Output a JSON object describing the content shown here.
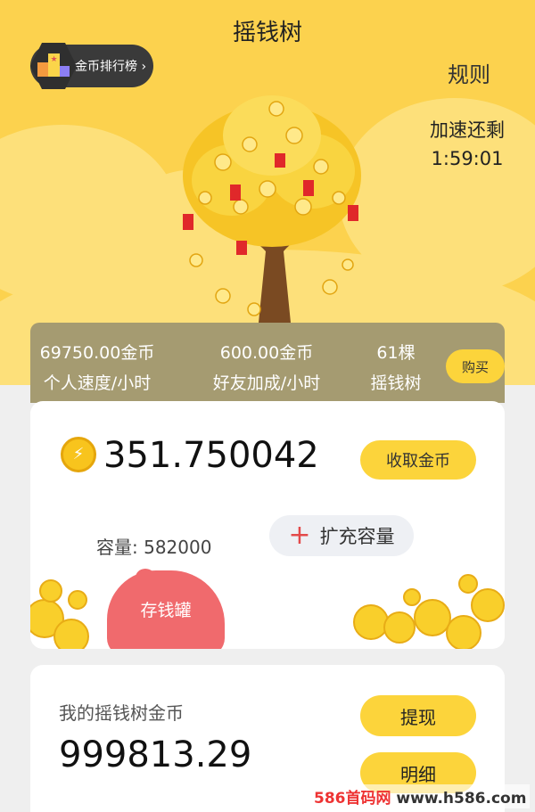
{
  "header": {
    "title": "摇钱树",
    "rank_label": "金币排行榜 ›",
    "rules_label": "规则"
  },
  "speedup": {
    "label": "加速还剩",
    "time": "1:59:01"
  },
  "stats": [
    {
      "value": "69750.00金币",
      "label": "个人速度/小时"
    },
    {
      "value": "600.00金币",
      "label": "好友加成/小时"
    },
    {
      "value": "61棵",
      "label": "摇钱树"
    }
  ],
  "buy_label": "购买",
  "wallet": {
    "balance": "351.750042",
    "collect_label": "收取金币",
    "capacity": "容量: 582000",
    "expand_label": "扩充容量",
    "piggy_label": "存钱罐"
  },
  "my_coins": {
    "label": "我的摇钱树金币",
    "value": "999813.29",
    "withdraw_label": "提现",
    "detail_label": "明细"
  },
  "watermark": {
    "brand": "586首码网",
    "url": "www.h586.com"
  },
  "colors": {
    "accent": "#fcd43b",
    "hero_bg": "#fcd24e",
    "stats_bg": "#a59b71"
  }
}
